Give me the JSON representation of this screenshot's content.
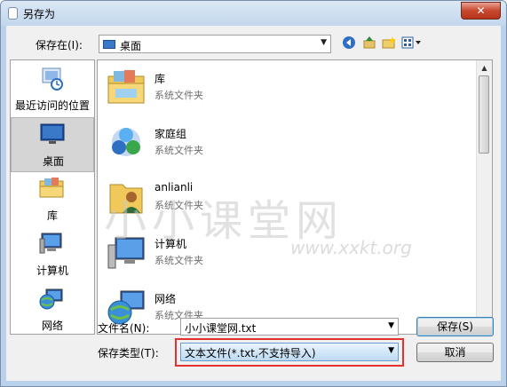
{
  "window": {
    "title": "另存为",
    "close_label": "✕"
  },
  "toolbar": {
    "savein_label": "保存在(I):",
    "savein_value": "桌面",
    "icons": [
      "back-icon",
      "up-folder-icon",
      "new-folder-icon",
      "view-menu-icon"
    ]
  },
  "places": [
    {
      "label": "最近访问的位置",
      "icon": "recent-places-icon"
    },
    {
      "label": "桌面",
      "icon": "desktop-icon",
      "selected": true
    },
    {
      "label": "库",
      "icon": "libraries-icon"
    },
    {
      "label": "计算机",
      "icon": "computer-icon"
    },
    {
      "label": "网络",
      "icon": "network-icon"
    }
  ],
  "files": [
    {
      "name": "库",
      "type": "系统文件夹",
      "icon": "libraries-icon"
    },
    {
      "name": "家庭组",
      "type": "系统文件夹",
      "icon": "homegroup-icon"
    },
    {
      "name": "anlianli",
      "type": "系统文件夹",
      "icon": "user-folder-icon"
    },
    {
      "name": "计算机",
      "type": "系统文件夹",
      "icon": "computer-icon"
    },
    {
      "name": "网络",
      "type": "系统文件夹",
      "icon": "network-icon"
    }
  ],
  "form": {
    "filename_label": "文件名(N):",
    "filename_value": "小小课堂网.txt",
    "filetype_label": "保存类型(T):",
    "filetype_value": "文本文件(*.txt,不支持导入)",
    "save_button": "保存(S)",
    "cancel_button": "取消"
  },
  "watermark": {
    "text": "小小课堂网",
    "url": "www.xxkt.org"
  },
  "colors": {
    "highlight_border": "#e53030",
    "accent": "#3a78c8"
  }
}
